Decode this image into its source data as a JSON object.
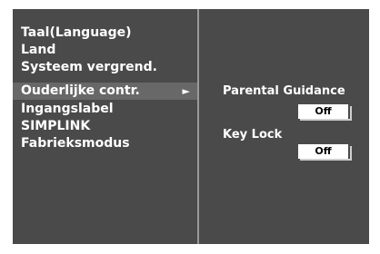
{
  "menu": {
    "items": [
      {
        "label": "Taal(Language)"
      },
      {
        "label": "Land"
      },
      {
        "label": "Systeem vergrend."
      },
      {
        "label": "Ouderlijke contr.",
        "selected": true,
        "arrow": "►"
      },
      {
        "label": "Ingangslabel"
      },
      {
        "label": "SIMPLINK"
      },
      {
        "label": "Fabrieksmodus"
      }
    ]
  },
  "settings": {
    "parental_guidance": {
      "label": "Parental Guidance",
      "value": "Off"
    },
    "key_lock": {
      "label": "Key Lock",
      "value": "Off"
    }
  },
  "colors": {
    "panel_bg": "#4a4a4a",
    "selected_bg": "#686868",
    "divider": "#9a9a9a",
    "text": "#ffffff"
  }
}
